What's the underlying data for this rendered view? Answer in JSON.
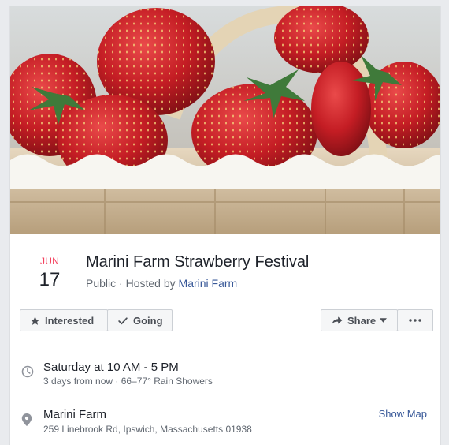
{
  "event": {
    "month": "JUN",
    "day": "17",
    "title": "Marini Farm Strawberry Festival",
    "privacy": "Public",
    "separator": " · ",
    "hosted_by_prefix": "Hosted by ",
    "host": "Marini Farm"
  },
  "actions": {
    "interested_label": "Interested",
    "going_label": "Going",
    "share_label": "Share"
  },
  "when": {
    "label": "Saturday at 10 AM - 5 PM",
    "details": "3 days from now · 66–77° Rain Showers"
  },
  "where": {
    "name": "Marini Farm",
    "address": "259 Linebrook Rd, Ipswich, Massachusetts 01938",
    "map_link": "Show Map"
  },
  "colors": {
    "month_accent": "#f3425f",
    "link": "#385898",
    "strawberry": "#c8202a"
  },
  "icons": {
    "interested": "star-icon",
    "going": "checkmark-icon",
    "share": "share-arrow-icon",
    "more": "more-dots-icon",
    "time": "clock-icon",
    "location": "map-pin-icon"
  }
}
